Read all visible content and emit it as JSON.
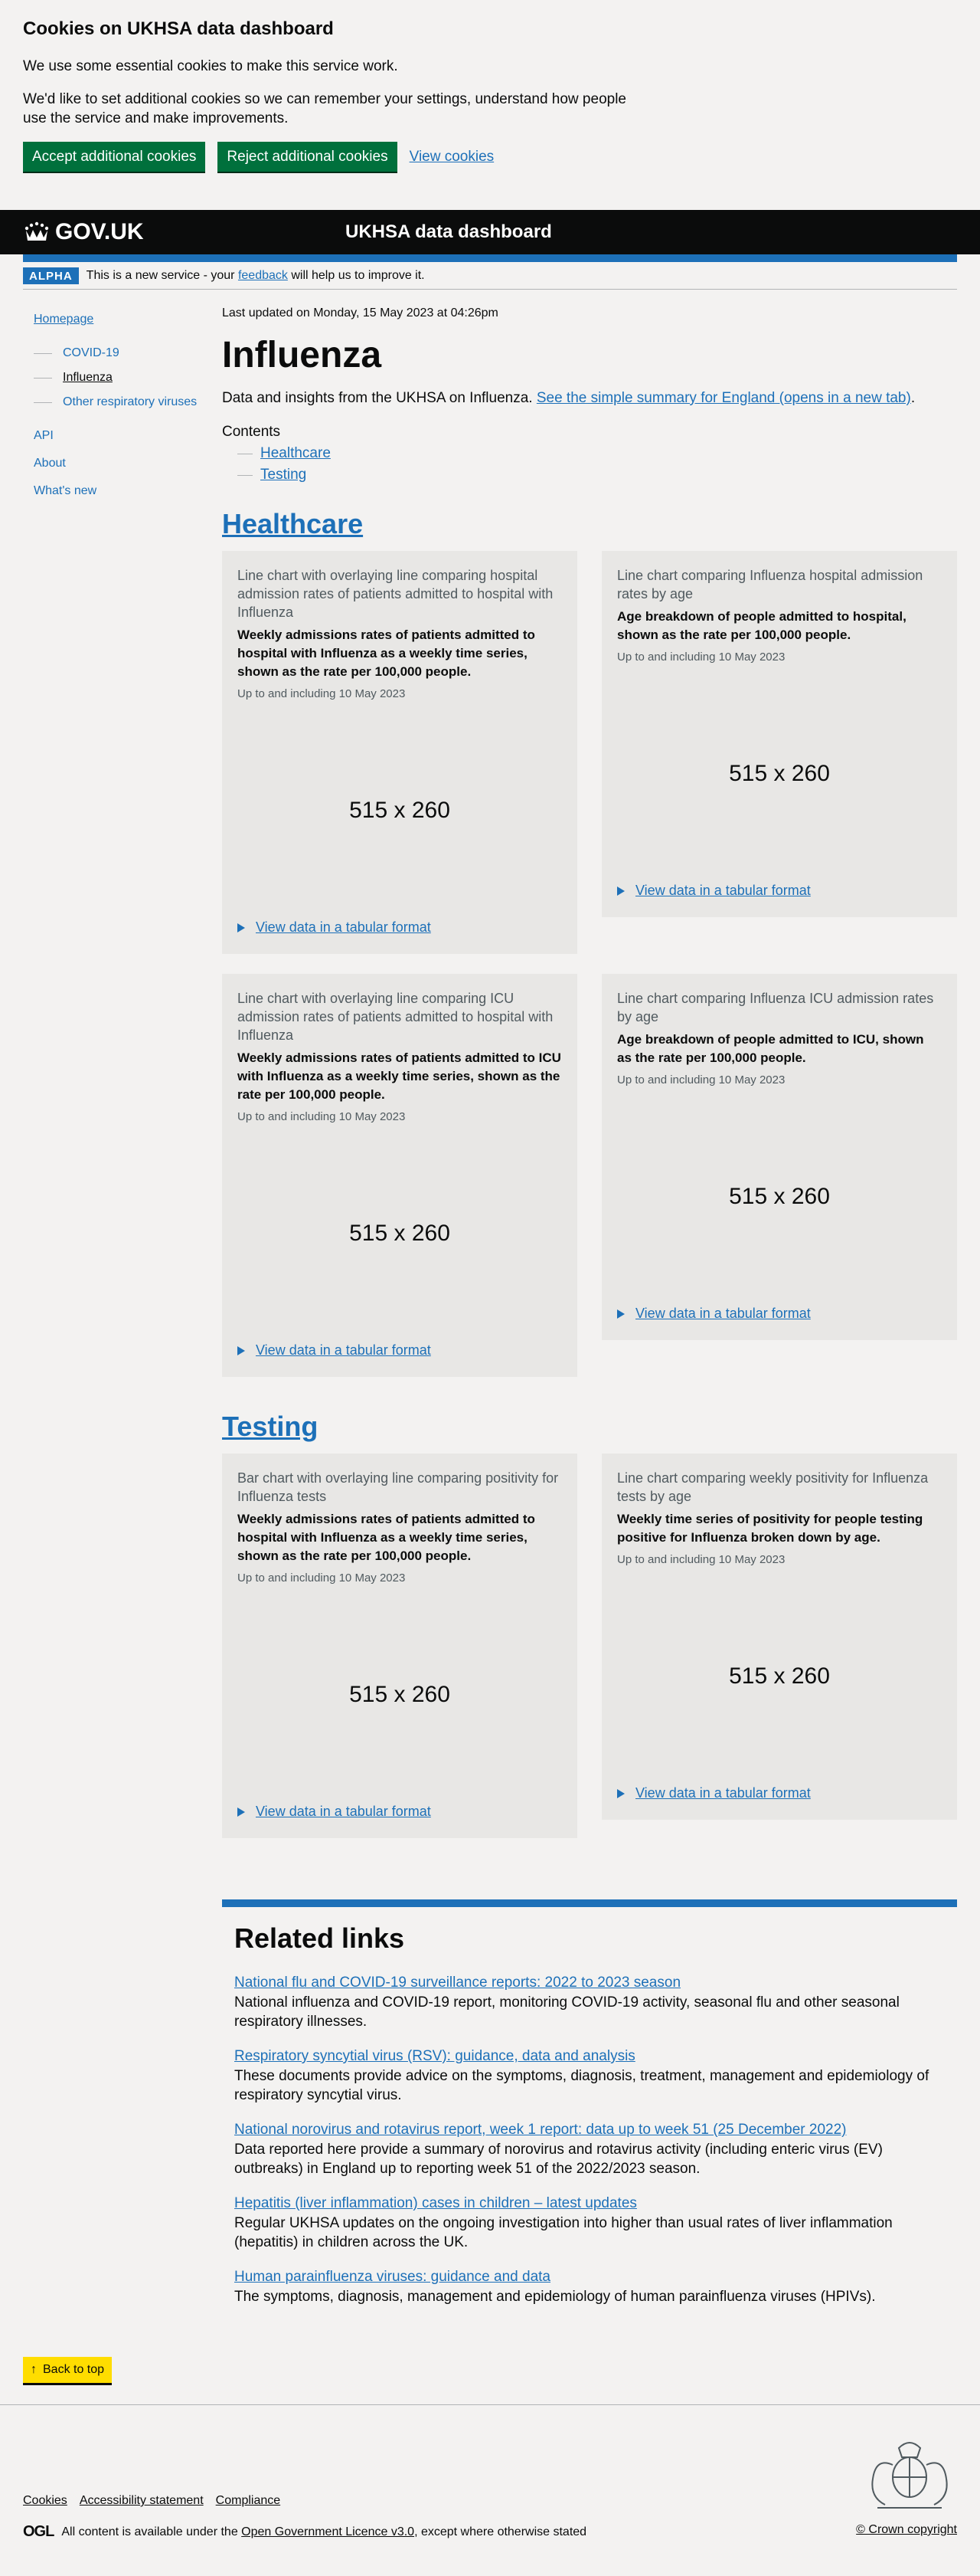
{
  "cookie_banner": {
    "title": "Cookies on UKHSA data dashboard",
    "p1": "We use some essential cookies to make this service work.",
    "p2": "We'd like to set additional cookies so we can remember your settings, understand how people use the service and make improvements.",
    "accept": "Accept additional cookies",
    "reject": "Reject additional cookies",
    "view": "View cookies"
  },
  "header": {
    "logo": "GOV.UK",
    "service": "UKHSA data dashboard"
  },
  "phase": {
    "tag": "ALPHA",
    "pre": "This is a new service - your ",
    "link": "feedback",
    "post": " will help us to improve it."
  },
  "sidebar": {
    "home": "Homepage",
    "sub": [
      "COVID-19",
      "Influenza",
      "Other respiratory viruses"
    ],
    "main": [
      "API",
      "About",
      "What's new"
    ]
  },
  "main": {
    "updated": "Last updated on Monday, 15 May 2023 at 04:26pm",
    "title": "Influenza",
    "intro": "Data and insights from the UKHSA on Influenza. ",
    "intro_link": "See the simple summary for England (opens in a new tab)",
    "intro_end": ".",
    "contents_title": "Contents",
    "contents": [
      "Healthcare",
      "Testing"
    ]
  },
  "sections": {
    "healthcare": {
      "title": "Healthcare",
      "cards": [
        {
          "title": "Line chart with overlaying line comparing hospital admission rates of patients admitted to hospital with Influenza",
          "desc": "Weekly admissions rates of patients admitted to hospital with Influenza as a weekly time series, shown as the rate per 100,000 people.",
          "date": "Up to and including 10 May 2023",
          "placeholder": "515 x 260",
          "link": "View data in a tabular format"
        },
        {
          "title": "Line chart comparing Influenza hospital admission rates by age",
          "desc": "Age breakdown of people admitted to hospital, shown as the rate per 100,000 people.",
          "date": "Up to and including 10 May 2023",
          "placeholder": "515 x 260",
          "link": "View data in a tabular format"
        },
        {
          "title": "Line chart with overlaying line comparing ICU admission rates of patients admitted to hospital with Influenza",
          "desc": "Weekly admissions rates of patients admitted to ICU with Influenza as a weekly time series, shown as the rate per 100,000 people.",
          "date": "Up to and including 10 May 2023",
          "placeholder": "515 x 260",
          "link": "View data in a tabular format"
        },
        {
          "title": "Line chart comparing Influenza ICU admission rates by age",
          "desc": "Age breakdown of people admitted to ICU, shown as the rate per 100,000 people.",
          "date": "Up to and including 10 May 2023",
          "placeholder": "515 x 260",
          "link": "View data in a tabular format"
        }
      ]
    },
    "testing": {
      "title": "Testing",
      "cards": [
        {
          "title": "Bar chart with overlaying line comparing positivity for Influenza tests",
          "desc": "Weekly admissions rates of patients admitted to hospital with Influenza as a weekly time series, shown as the rate per 100,000 people.",
          "date": "Up to and including 10 May 2023",
          "placeholder": "515 x 260",
          "link": "View data in a tabular format"
        },
        {
          "title": "Line chart comparing weekly positivity for Influenza tests by age",
          "desc": "Weekly time series of positivity for people testing positive for Influenza broken down by age.",
          "date": "Up to and including 10 May 2023",
          "placeholder": "515 x 260",
          "link": "View data in a tabular format"
        }
      ]
    }
  },
  "related": {
    "title": "Related links",
    "links": [
      {
        "label": "National flu and COVID-19 surveillance reports: 2022 to 2023 season",
        "desc": "National influenza and COVID-19 report, monitoring COVID-19 activity, seasonal flu and other seasonal respiratory illnesses."
      },
      {
        "label": "Respiratory syncytial virus (RSV): guidance, data and analysis",
        "desc": "These documents provide advice on the symptoms, diagnosis, treatment, management and epidemiology of respiratory syncytial virus."
      },
      {
        "label": "National norovirus and rotavirus report, week 1 report: data up to week 51 (25 December 2022)",
        "desc": "Data reported here provide a summary of norovirus and rotavirus activity (including enteric virus (EV) outbreaks) in England up to reporting week 51 of the 2022/2023 season."
      },
      {
        "label": "Hepatitis (liver inflammation) cases in children – latest updates",
        "desc": "Regular UKHSA updates on the ongoing investigation into higher than usual rates of liver inflammation (hepatitis) in children across the UK."
      },
      {
        "label": "Human parainfluenza viruses: guidance and data",
        "desc": "The symptoms, diagnosis, management and epidemiology of human parainfluenza viruses (HPIVs)."
      }
    ]
  },
  "back_to_top": "Back to top",
  "footer": {
    "links": [
      "Cookies",
      "Accessibility statement",
      "Compliance"
    ],
    "ogl": "OGL",
    "licence_pre": "All content is available under the ",
    "licence_link": "Open Government Licence v3.0",
    "licence_post": ", except where otherwise stated",
    "copyright": "© Crown copyright"
  },
  "colors": {
    "link": "#1d70b8",
    "green_button": "#00703c",
    "header": "#0b0c0c",
    "back_to_top": "#ffdd00"
  }
}
